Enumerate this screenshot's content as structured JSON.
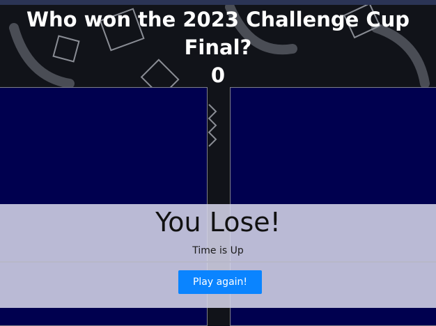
{
  "quiz": {
    "question": "Who won the 2023 Challenge Cup Final?",
    "score": "0"
  },
  "result": {
    "title": "You Lose!",
    "subtitle": "Time is Up",
    "play_again_label": "Play again!"
  },
  "colors": {
    "tile_background": "#00004f",
    "overlay_background": "#d4d4e8",
    "button_background": "#0a84ff",
    "page_background": "#111319"
  }
}
